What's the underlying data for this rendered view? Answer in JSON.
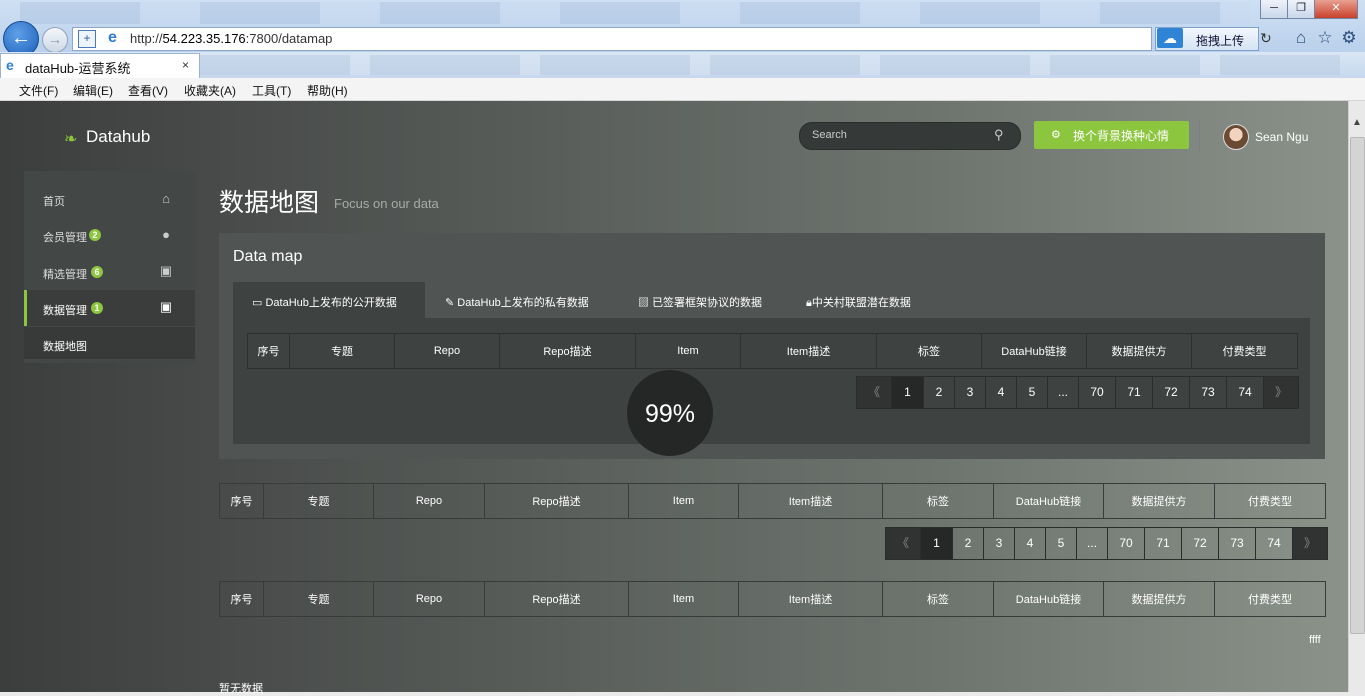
{
  "browser": {
    "url_prefix": "http://",
    "url_host": "54.223.35.176",
    "url_rest": ":7800/datamap",
    "tab_title": "dataHub-运营系统",
    "tab_close": "×",
    "upload_label": "拖拽上传",
    "window_buttons": [
      "─",
      "❐",
      "✕"
    ],
    "menu": [
      "文件(F)",
      "编辑(E)",
      "查看(V)",
      "收藏夹(A)",
      "工具(T)",
      "帮助(H)"
    ]
  },
  "header": {
    "logo": "Datahub",
    "search_placeholder": "Search",
    "bg_button": "换个背景换种心情",
    "user_name": "Sean Ngu"
  },
  "sidebar": {
    "items": [
      {
        "label": "首页",
        "badge": "",
        "icon": "home-icon"
      },
      {
        "label": "会员管理",
        "badge": "2",
        "icon": "user-icon"
      },
      {
        "label": "精选管理",
        "badge": "6",
        "icon": "briefcase-icon"
      },
      {
        "label": "数据管理",
        "badge": "1",
        "icon": "briefcase-icon"
      }
    ],
    "sub_item": "数据地图"
  },
  "page": {
    "title": "数据地图",
    "subtitle": "Focus on our data",
    "panel_title": "Data map",
    "tabs": [
      {
        "label": "DataHub上发布的公开数据",
        "icon": "monitor-icon"
      },
      {
        "label": "DataHub上发布的私有数据",
        "icon": "edit-icon"
      },
      {
        "label": "已签署框架协议的数据",
        "icon": "image-icon"
      },
      {
        "label": "中关村联盟潜在数据",
        "icon": "lock-icon"
      }
    ],
    "columns": [
      "序号",
      "专题",
      "Repo",
      "Repo描述",
      "Item",
      "Item描述",
      "标签",
      "DataHub链接",
      "数据提供方",
      "付费类型"
    ],
    "pager": [
      "《",
      "1",
      "2",
      "3",
      "4",
      "5",
      "...",
      "70",
      "71",
      "72",
      "73",
      "74",
      "》"
    ],
    "loading": "99%",
    "ffff": "ffff",
    "no_data": "暂无数据"
  },
  "colors": {
    "accent": "#8cc63f"
  }
}
